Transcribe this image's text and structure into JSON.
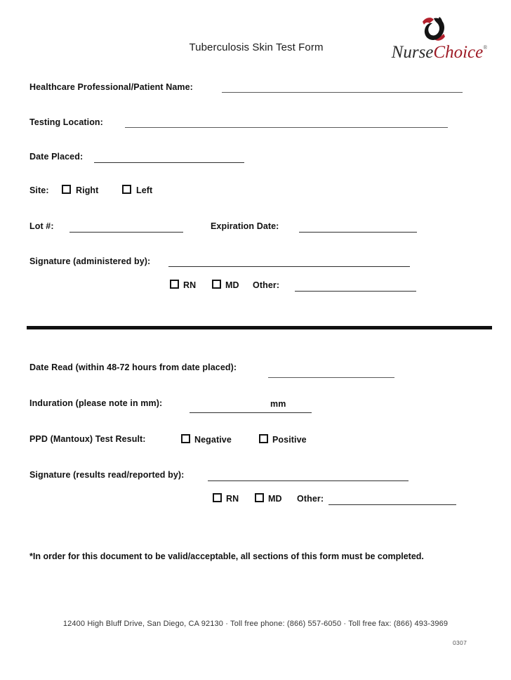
{
  "document": {
    "title": "Tuberculosis Skin Test Form"
  },
  "brand": {
    "name_part1": "Nurse",
    "name_part2": "Choice",
    "trademark": "®",
    "color_dark": "#2b2b2b",
    "color_red": "#9e1b26",
    "mark_name": "nursechoice-logo-mark"
  },
  "section_placed": {
    "patient_name_label": "Healthcare Professional/Patient Name:",
    "testing_location_label": "Testing Location:",
    "date_placed_label": "Date Placed:",
    "site_label": "Site:",
    "site_options": [
      {
        "label": "Right",
        "checked": false
      },
      {
        "label": "Left",
        "checked": false
      }
    ],
    "lot_label": "Lot #:",
    "expiration_label": "Expiration Date:",
    "signature_label": "Signature (administered by):",
    "credential_options": [
      {
        "label": "RN",
        "checked": false
      },
      {
        "label": "MD",
        "checked": false
      }
    ],
    "other_label": "Other:"
  },
  "section_read": {
    "date_read_label": "Date Read (within 48-72 hours from date placed):",
    "induration_label": "Induration (please note in mm):",
    "induration_unit": "mm",
    "ppd_label": "PPD (Mantoux) Test Result:",
    "ppd_options": [
      {
        "label": "Negative",
        "checked": false
      },
      {
        "label": "Positive",
        "checked": false
      }
    ],
    "signature_label": "Signature (results read/reported by):",
    "credential_options": [
      {
        "label": "RN",
        "checked": false
      },
      {
        "label": "MD",
        "checked": false
      }
    ],
    "other_label": "Other:"
  },
  "notice": {
    "text": "*In order for this document to be valid/acceptable, all sections of this form must be completed."
  },
  "footer": {
    "address_line": "12400 High Bluff Drive, San Diego, CA  92130   ·   Toll free phone: (866) 557-6050   ·   Toll free fax: (866) 493-3969",
    "revision_code": "0307"
  }
}
